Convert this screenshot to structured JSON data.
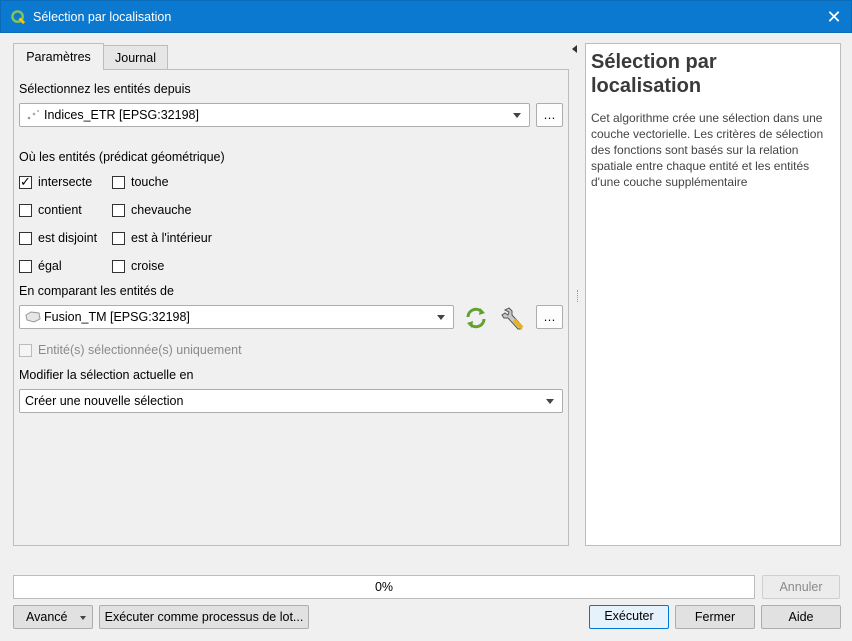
{
  "window": {
    "title": "Sélection par localisation",
    "close_glyph": "✕"
  },
  "tabs": [
    {
      "label": "Paramètres",
      "active": true
    },
    {
      "label": "Journal",
      "active": false
    }
  ],
  "params": {
    "source_label": "Sélectionnez les entités depuis",
    "source_layer": "Indices_ETR [EPSG:32198]",
    "predicate_label": "Où les entités (prédicat géométrique)",
    "predicates": [
      {
        "label": "intersecte",
        "checked": true
      },
      {
        "label": "touche",
        "checked": false
      },
      {
        "label": "contient",
        "checked": false
      },
      {
        "label": "chevauche",
        "checked": false
      },
      {
        "label": "est disjoint",
        "checked": false
      },
      {
        "label": "est à l'intérieur",
        "checked": false
      },
      {
        "label": "égal",
        "checked": false
      },
      {
        "label": "croise",
        "checked": false
      }
    ],
    "compare_label": "En comparant les entités de",
    "compare_layer": "Fusion_TM [EPSG:32198]",
    "selected_only_label": "Entité(s) sélectionnée(s) uniquement",
    "modify_label": "Modifier la sélection actuelle en",
    "modify_value": "Créer une nouvelle sélection",
    "browse_label": "…"
  },
  "help": {
    "title": "Sélection par localisation",
    "text": "Cet algorithme crée une sélection dans une couche vectorielle. Les critères de sélection des fonctions sont basés sur la relation spatiale entre chaque entité et les entités d'une couche supplémentaire"
  },
  "progress": {
    "value": 0,
    "label": "0%"
  },
  "buttons": {
    "cancel": "Annuler",
    "advanced": "Avancé",
    "batch": "Exécuter comme processus de lot...",
    "run": "Exécuter",
    "close": "Fermer",
    "help": "Aide"
  }
}
